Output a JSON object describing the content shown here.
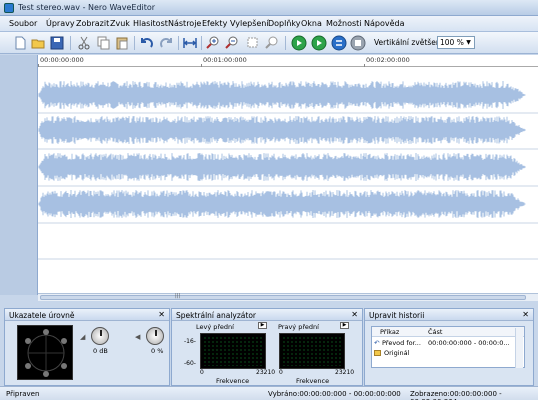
{
  "window": {
    "title": "Test stereo.wav - Nero WaveEditor"
  },
  "menu": {
    "items": [
      "Soubor",
      "Úpravy",
      "Zobrazit",
      "Zvuk",
      "Hlasitost",
      "Nástroje",
      "Efekty",
      "Vylepšení",
      "Doplňky",
      "Okna",
      "Možnosti",
      "Nápověda"
    ]
  },
  "toolbar": {
    "zoom_label": "Vertikální zvětšení:",
    "zoom_value": "100 %"
  },
  "ruler": {
    "labels": [
      "00:00:00:000",
      "00:01:00:000",
      "00:02:00:000"
    ]
  },
  "panels": {
    "levels": {
      "title": "Ukazatele úrovně",
      "close": "✕",
      "gain_value": "0 dB",
      "pan_value": "0 %"
    },
    "spectrum": {
      "title": "Spektrální analyzátor",
      "close": "✕",
      "left_label": "Levý přední",
      "right_label": "Pravý přední",
      "y_top": "-16-",
      "y_bottom": "-60-",
      "x_min_left": "0",
      "x_max_left": "23210",
      "x_min_right": "0",
      "x_max_right": "23210",
      "x_label_left": "Frekvence",
      "x_label_right": "Frekvence"
    },
    "history": {
      "title": "Upravit historii",
      "close": "✕",
      "col_command": "Příkaz",
      "col_part": "Část",
      "rows": [
        {
          "command": "Převod for...",
          "part": "00:00:00:000 - 00:00:0..."
        },
        {
          "command": "Originál",
          "part": ""
        }
      ]
    }
  },
  "status": {
    "left": "Připraven",
    "selection": "Vybráno:00:00:00:000 - 00:00:00:000",
    "view": "Zobrazeno:00:00:00:000 - 00:03:00:864"
  },
  "colors": {
    "waveform": "#a7c0e2",
    "accent": "#2a7ad0",
    "panel_bg": "#d9e4f2"
  }
}
